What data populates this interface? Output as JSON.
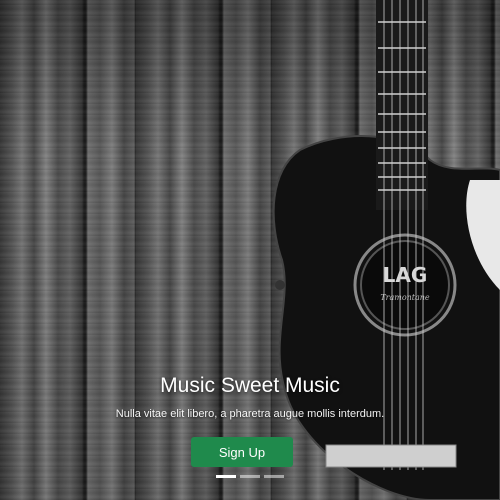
{
  "hero": {
    "title": "Music Sweet Music",
    "subtitle": "Nulla vitae elit libero, a pharetra augue mollis interdum.",
    "button_label": "Sign Up",
    "button_color": "#1f8a4c"
  },
  "carousel": {
    "slide_count": 3,
    "active_index": 0
  },
  "guitar_logo": "LAG",
  "guitar_brand": "Tramontane"
}
